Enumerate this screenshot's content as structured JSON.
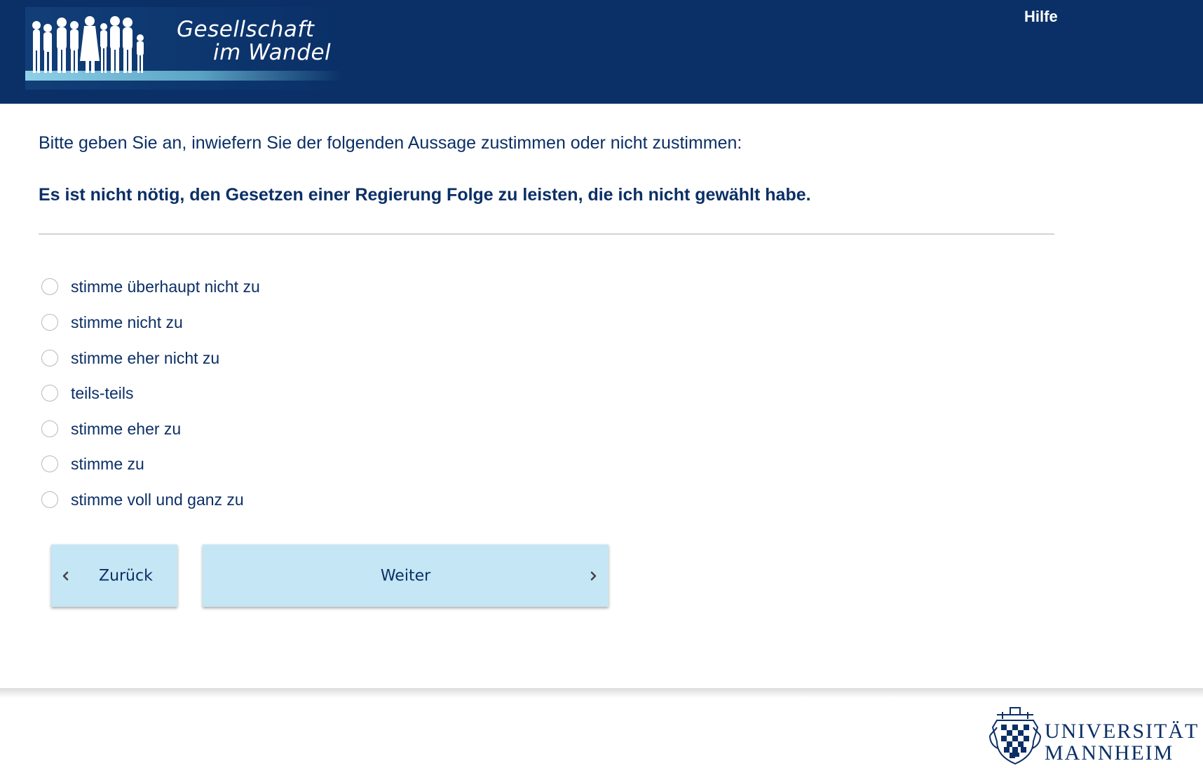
{
  "header": {
    "logo": {
      "line1": "Gesellschaft",
      "line2": "im Wandel"
    },
    "help_label": "Hilfe"
  },
  "question": {
    "intro": "Bitte geben Sie an, inwiefern Sie der folgenden Aussage zustimmen oder nicht zustimmen:",
    "statement": "Es ist nicht nötig, den Gesetzen einer Regierung Folge zu leisten, die ich nicht gewählt habe."
  },
  "options": [
    {
      "label": "stimme überhaupt nicht zu",
      "selected": false
    },
    {
      "label": "stimme nicht zu",
      "selected": false
    },
    {
      "label": "stimme eher nicht zu",
      "selected": false
    },
    {
      "label": "teils-teils",
      "selected": false
    },
    {
      "label": "stimme eher zu",
      "selected": false
    },
    {
      "label": "stimme zu",
      "selected": false
    },
    {
      "label": "stimme voll und ganz zu",
      "selected": false
    }
  ],
  "navigation": {
    "back_label": "Zurück",
    "next_label": "Weiter"
  },
  "footer": {
    "university_line1": "UNIVERSITÄT",
    "university_line2": "MANNHEIM"
  },
  "colors": {
    "header_bg": "#0a3067",
    "text": "#0b2f66",
    "button_bg": "#c5e6f4"
  },
  "icons": {
    "back": "chevron-left-icon",
    "next": "chevron-right-icon",
    "help": "none",
    "footer": "university-crest-icon"
  }
}
